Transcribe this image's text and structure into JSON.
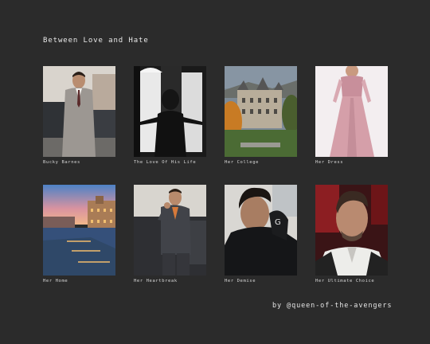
{
  "header": {
    "title": "Between Love and Hate"
  },
  "tiles": [
    {
      "caption": "Bucky Barnes",
      "image": "man-in-grey-suit-photo"
    },
    {
      "caption": "The Love Of His Life",
      "image": "woman-silhouette-window-photo"
    },
    {
      "caption": "Her College",
      "image": "college-campus-autumn-photo"
    },
    {
      "caption": "Her Dress",
      "image": "pink-gown-photo"
    },
    {
      "caption": "Her Home",
      "image": "venice-canal-dusk-photo"
    },
    {
      "caption": "Her Heartbreak",
      "image": "man-in-suit-smoking-photo"
    },
    {
      "caption": "Her Demise",
      "image": "young-man-black-hoodie-photo"
    },
    {
      "caption": "Her Ultimate Choice",
      "image": "man-white-shirt-closeup-photo"
    }
  ],
  "footer": {
    "credit": "by @queen-of-the-avengers"
  },
  "colors": {
    "background": "#2b2b2b",
    "text": "#e6e6e6"
  }
}
